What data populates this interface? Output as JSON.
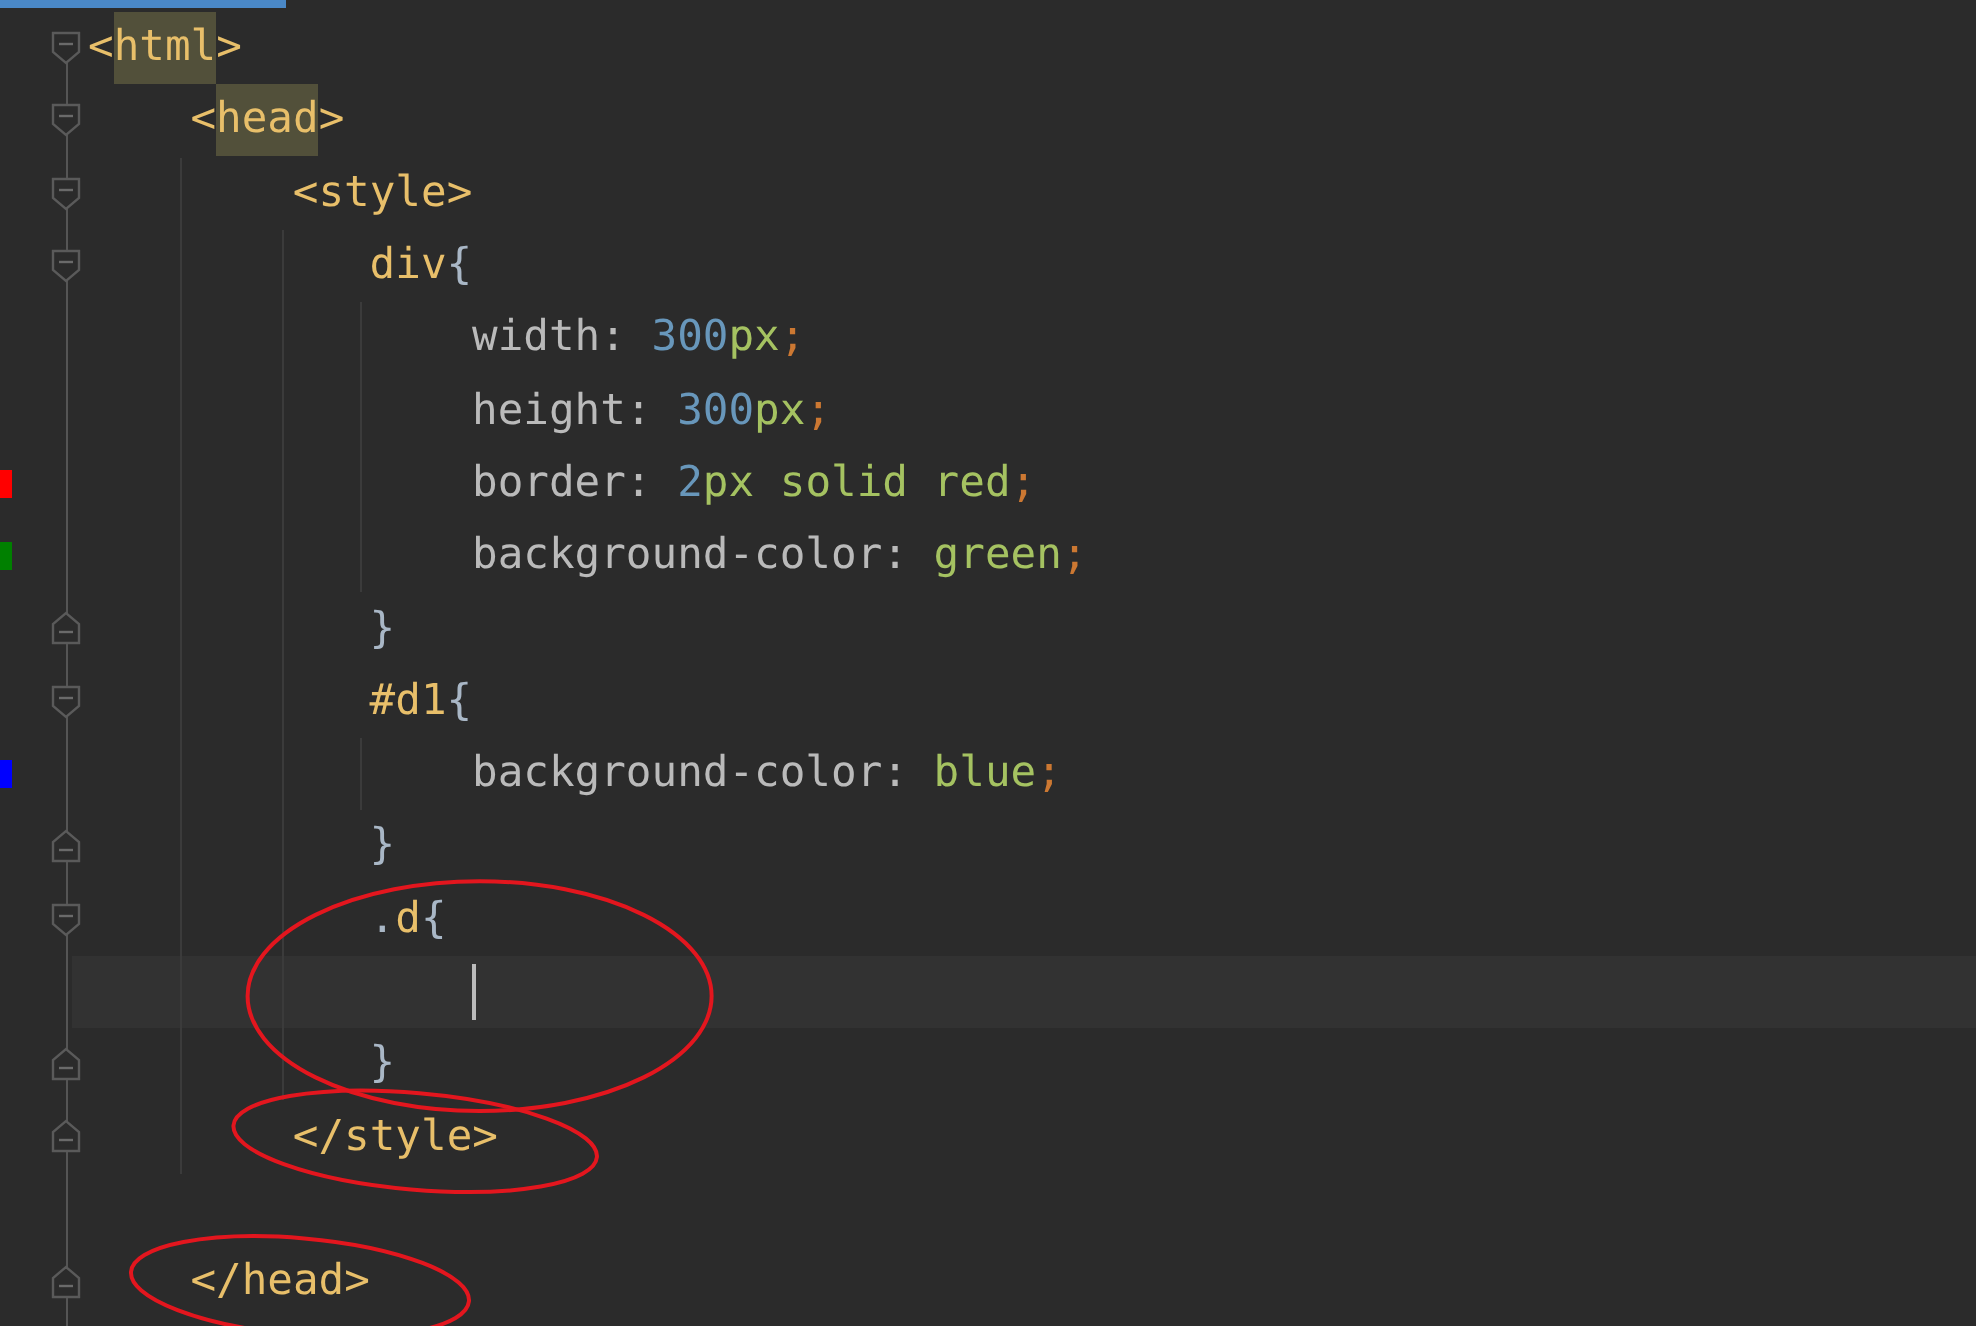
{
  "editor": {
    "lines": [
      {
        "kind": "block",
        "open": [
          {
            "text": "<",
            "kind": "tag"
          },
          {
            "text": "html",
            "kind": "tag",
            "highlighted": true
          },
          {
            "text": ">",
            "kind": "tag"
          }
        ],
        "children": [
          {
            "kind": "block",
            "open": [
              {
                "text": "<",
                "kind": "tag"
              },
              {
                "text": "head",
                "kind": "tag",
                "highlighted": true
              },
              {
                "text": ">",
                "kind": "tag"
              }
            ],
            "children": [
              {
                "kind": "block",
                "open": [
                  {
                    "text": "<style>",
                    "kind": "tag"
                  }
                ],
                "children": [
                  {
                    "kind": "block",
                    "open": [
                      {
                        "text": "div",
                        "kind": "selector"
                      },
                      {
                        "text": "{",
                        "kind": "brace"
                      }
                    ],
                    "children": [
                      {
                        "kind": "line",
                        "tokens": [
                          {
                            "text": "width: ",
                            "kind": "property"
                          },
                          {
                            "text": "300",
                            "kind": "number"
                          },
                          {
                            "text": "px",
                            "kind": "value"
                          },
                          {
                            "text": ";",
                            "kind": "punct"
                          }
                        ]
                      },
                      {
                        "kind": "line",
                        "tokens": [
                          {
                            "text": "height: ",
                            "kind": "property"
                          },
                          {
                            "text": "300",
                            "kind": "number"
                          },
                          {
                            "text": "px",
                            "kind": "value"
                          },
                          {
                            "text": ";",
                            "kind": "punct"
                          }
                        ]
                      },
                      {
                        "kind": "line",
                        "color": "#ff0000",
                        "tokens": [
                          {
                            "text": "border: ",
                            "kind": "property"
                          },
                          {
                            "text": "2",
                            "kind": "number"
                          },
                          {
                            "text": "px solid red",
                            "kind": "value"
                          },
                          {
                            "text": ";",
                            "kind": "punct"
                          }
                        ]
                      },
                      {
                        "kind": "line",
                        "color": "#008000",
                        "tokens": [
                          {
                            "text": "background-color: ",
                            "kind": "property"
                          },
                          {
                            "text": "green",
                            "kind": "value"
                          },
                          {
                            "text": ";",
                            "kind": "punct"
                          }
                        ]
                      }
                    ],
                    "close": [
                      {
                        "text": "}",
                        "kind": "brace"
                      }
                    ]
                  },
                  {
                    "kind": "block",
                    "open": [
                      {
                        "text": "#d1",
                        "kind": "selector"
                      },
                      {
                        "text": "{",
                        "kind": "brace"
                      }
                    ],
                    "children": [
                      {
                        "kind": "line",
                        "color": "#0000ff",
                        "tokens": [
                          {
                            "text": "background-color: ",
                            "kind": "property"
                          },
                          {
                            "text": "blue",
                            "kind": "value"
                          },
                          {
                            "text": ";",
                            "kind": "punct"
                          }
                        ]
                      }
                    ],
                    "close": [
                      {
                        "text": "}",
                        "kind": "brace"
                      }
                    ]
                  },
                  {
                    "kind": "block",
                    "circled": true,
                    "open": [
                      {
                        "text": ".",
                        "kind": "brace"
                      },
                      {
                        "text": "d",
                        "kind": "selector"
                      },
                      {
                        "text": "{",
                        "kind": "brace"
                      }
                    ],
                    "children": [
                      {
                        "kind": "blank",
                        "current": true
                      }
                    ],
                    "close": [
                      {
                        "text": "}",
                        "kind": "brace"
                      }
                    ]
                  }
                ],
                "close_circled": true,
                "close": [
                  {
                    "text": "</style>",
                    "kind": "tag"
                  }
                ]
              },
              {
                "kind": "blank",
                "current": false
              }
            ],
            "close_circled": true,
            "close": [
              {
                "text": "</head>",
                "kind": "tag"
              }
            ]
          }
        ]
      }
    ]
  }
}
